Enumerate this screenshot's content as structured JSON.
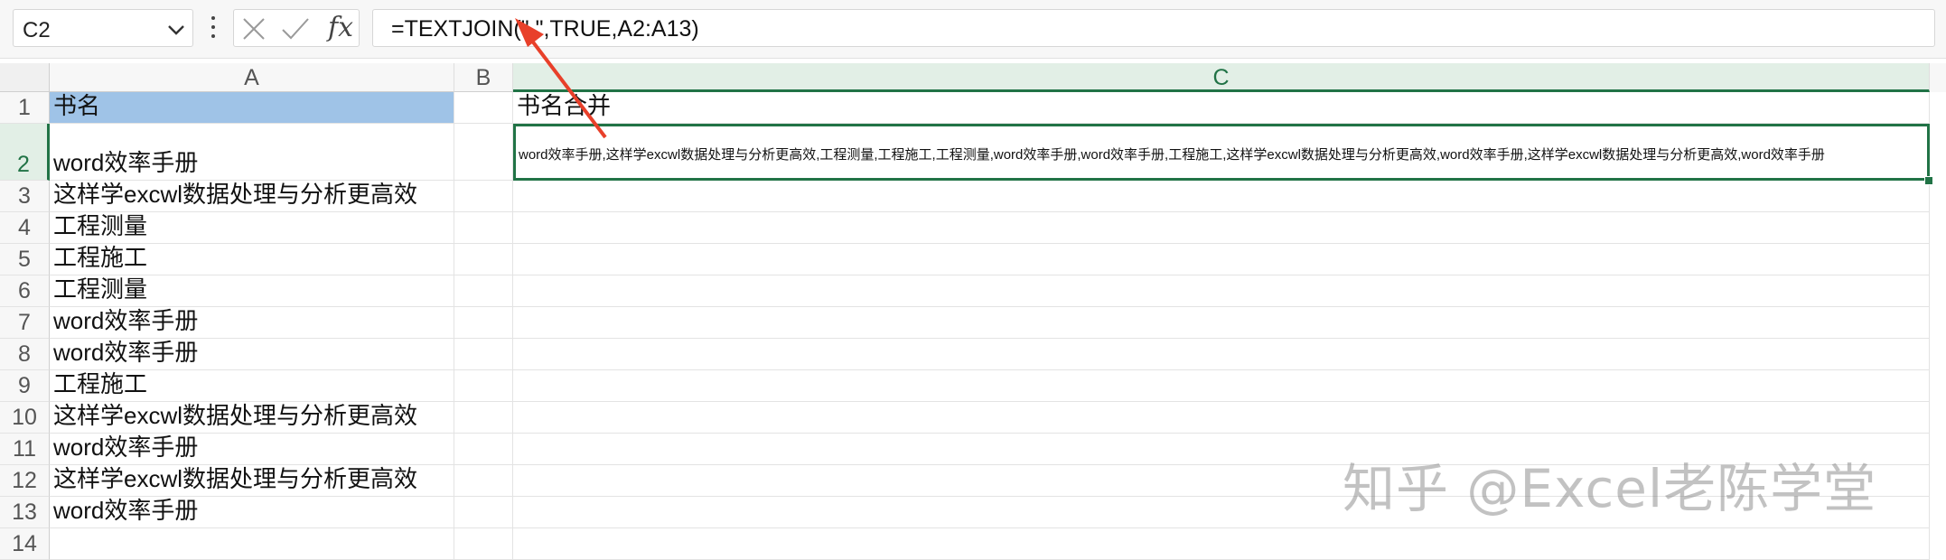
{
  "name_box": {
    "value": "C2"
  },
  "formula_bar": {
    "fx_label": "fx",
    "formula": "=TEXTJOIN(\",\",TRUE,A2:A13)"
  },
  "columns": [
    "A",
    "B",
    "C"
  ],
  "rows": [
    "1",
    "2",
    "3",
    "4",
    "5",
    "6",
    "7",
    "8",
    "9",
    "10",
    "11",
    "12",
    "13",
    "14"
  ],
  "cells": {
    "A1": "书名",
    "A2": "word效率手册",
    "A3": "这样学excwl数据处理与分析更高效",
    "A4": "工程测量",
    "A5": "工程施工",
    "A6": "工程测量",
    "A7": "word效率手册",
    "A8": "word效率手册",
    "A9": "工程施工",
    "A10": "这样学excwl数据处理与分析更高效",
    "A11": "word效率手册",
    "A12": "这样学excwl数据处理与分析更高效",
    "A13": "word效率手册",
    "C1": "书名合并",
    "C2": "word效率手册,这样学excwl数据处理与分析更高效,工程测量,工程施工,工程测量,word效率手册,word效率手册,工程施工,这样学excwl数据处理与分析更高效,word效率手册,这样学excwl数据处理与分析更高效,word效率手册"
  },
  "watermark": "知乎 @Excel老陈学堂",
  "colors": {
    "accent": "#217346",
    "header_fill": "#9fc3e7",
    "arrow": "#e8402a"
  }
}
